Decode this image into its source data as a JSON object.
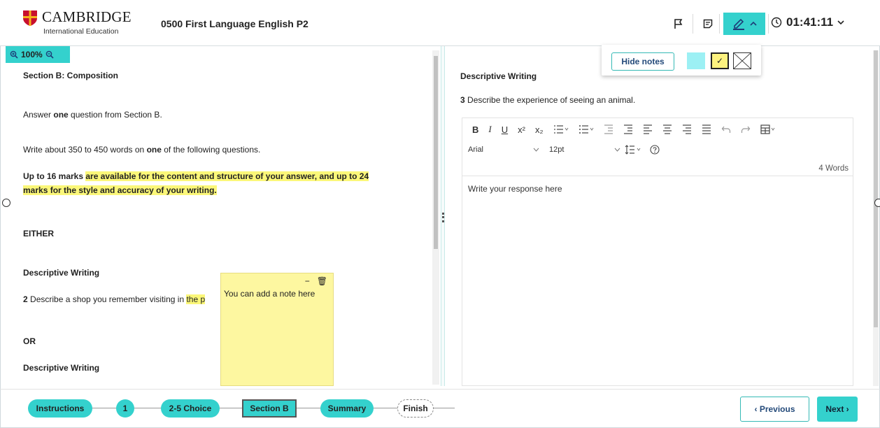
{
  "header": {
    "brand": "CAMBRIDGE",
    "brand_sub": "International Education",
    "exam_title": "0500 First Language English P2",
    "timer": "01:41:11",
    "icons": [
      "flag-icon",
      "notes-icon",
      "pen-icon",
      "chevron-up-icon",
      "clock-icon",
      "chevron-down-icon"
    ]
  },
  "notes_popover": {
    "hide_notes_label": "Hide notes",
    "colors": [
      "#9cf0f4",
      "#fdf27f"
    ],
    "selected_check": "✓"
  },
  "zoom": {
    "level": "100%"
  },
  "left": {
    "section_title": "Section B: Composition",
    "answer_prefix": "Answer ",
    "answer_bold": "one",
    "answer_suffix": " question from Section B.",
    "write_prefix": "Write about 350 to 450 words on ",
    "write_bold": "one",
    "write_suffix": " of the following questions.",
    "marks_plain": "Up to 16 marks ",
    "marks_hl1": "are available for the content and structure of your answer, and up to 24",
    "marks_hl2": "marks for the style and accuracy of your writing.",
    "either": "EITHER",
    "desc_heading_1": "Descriptive Writing",
    "q2_num": "2",
    "q2_text": " Describe a shop you remember visiting in ",
    "q2_hl": "the p",
    "or": "OR",
    "desc_heading_2": "Descriptive Writing"
  },
  "note": {
    "text": "You can add a note here",
    "minimize": "−",
    "delete": "🗑"
  },
  "right": {
    "heading": "Descriptive Writing",
    "q_num": "3",
    "q_text": " Describe the experience of seeing an animal.",
    "font": "Arial",
    "size": "12pt",
    "word_count": "4 Words",
    "response": "Write your response here"
  },
  "toolbar": {
    "bold": "B",
    "italic": "I",
    "underline": "U",
    "superscript": "x²",
    "subscript": "x₂"
  },
  "footer": {
    "steps": [
      "Instructions",
      "1",
      "2-5 Choice",
      "Section B",
      "Summary",
      "Finish"
    ],
    "previous": "‹ Previous",
    "next": "Next ›"
  }
}
